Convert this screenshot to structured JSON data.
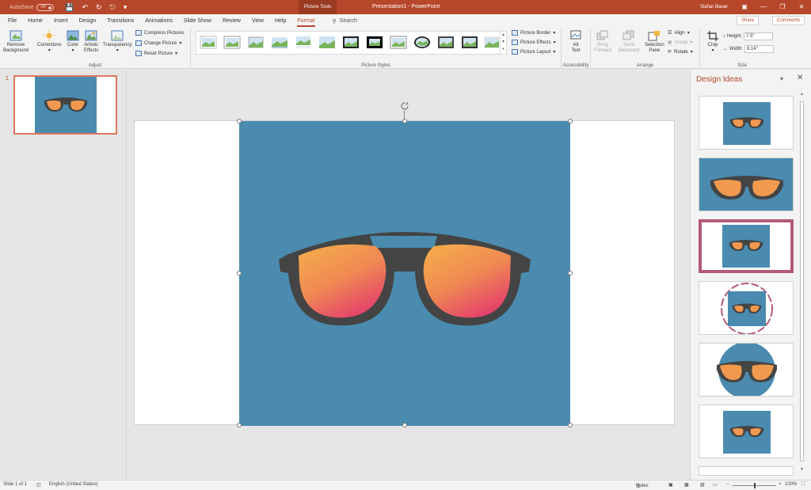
{
  "titlebar": {
    "autosave_label": "AutoSave",
    "autosave_state": "Off",
    "context_tab": "Picture Tools",
    "doc_title": "Presentation1 - PowerPoint",
    "user": "Stefan Bauer"
  },
  "tabs": [
    "File",
    "Home",
    "Insert",
    "Design",
    "Transitions",
    "Animations",
    "Slide Show",
    "Review",
    "View",
    "Help",
    "Format"
  ],
  "active_tab": "Format",
  "search_label": "Search",
  "share_label": "Share",
  "comments_label": "Comments",
  "ribbon": {
    "adjust": {
      "remove_bg_1": "Remove",
      "remove_bg_2": "Background",
      "corrections": "Corrections",
      "color": "Color",
      "artistic_1": "Artistic",
      "artistic_2": "Effects",
      "transparency": "Transparency",
      "compress": "Compress Pictures",
      "change": "Change Picture",
      "reset": "Reset Picture",
      "label": "Adjust"
    },
    "picture_styles": {
      "label": "Picture Styles",
      "border": "Picture Border",
      "effects": "Picture Effects",
      "layout": "Picture Layout"
    },
    "accessibility": {
      "alt_1": "Alt",
      "alt_2": "Text",
      "label": "Accessibility"
    },
    "arrange": {
      "bring_1": "Bring",
      "bring_2": "Forward",
      "send_1": "Send",
      "send_2": "Backward",
      "selection_1": "Selection",
      "selection_2": "Pane",
      "align": "Align",
      "group": "Group",
      "rotate": "Rotate",
      "label": "Arrange"
    },
    "size": {
      "crop": "Crop",
      "height_label": "Height:",
      "height_value": "7.5\"",
      "width_label": "Width:",
      "width_value": "8.14\"",
      "label": "Size"
    }
  },
  "slides_pane": {
    "slide_number": "1"
  },
  "design_ideas": {
    "title": "Design Ideas"
  },
  "statusbar": {
    "slide_info": "Slide 1 of 1",
    "language": "English (United States)",
    "notes": "Notes",
    "zoom": "100%"
  },
  "colors": {
    "accent": "#b7472a",
    "picture_bg": "#4a8baf",
    "lens_top": "#f5b04a",
    "lens_bottom": "#e5446a",
    "frame": "#444444",
    "mauve_frame": "#b35a78"
  },
  "icons": [
    "save-icon",
    "undo-icon",
    "redo-icon",
    "present-icon",
    "search-icon",
    "minimize-icon",
    "restore-icon",
    "close-icon",
    "rotate-handle-icon"
  ]
}
